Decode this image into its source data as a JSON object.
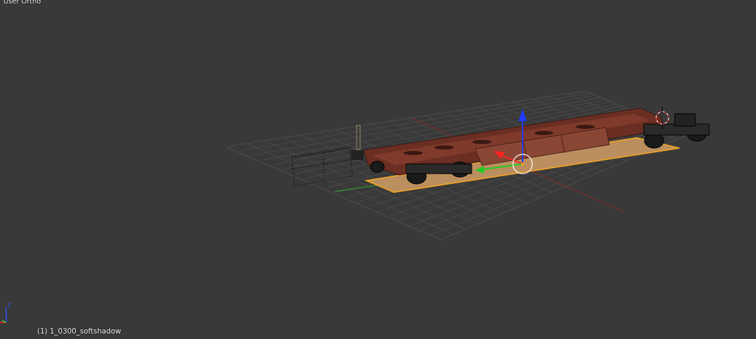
{
  "viewport": {
    "view_name": "User Ortho",
    "active_object": "(1) 1_0300_softshadow",
    "background_color": "#393939",
    "grid_color": "#555555",
    "x_axis_color": "#8a2a2a",
    "y_axis_color": "#3aa53a",
    "selection_color": "#f5a623",
    "wagon_color": "#6b2e22"
  },
  "axis_gizmo": {
    "z_label": "z"
  },
  "transform_manipulator": {
    "axes": [
      "x-arrow",
      "y-arrow",
      "z-arrow"
    ]
  }
}
